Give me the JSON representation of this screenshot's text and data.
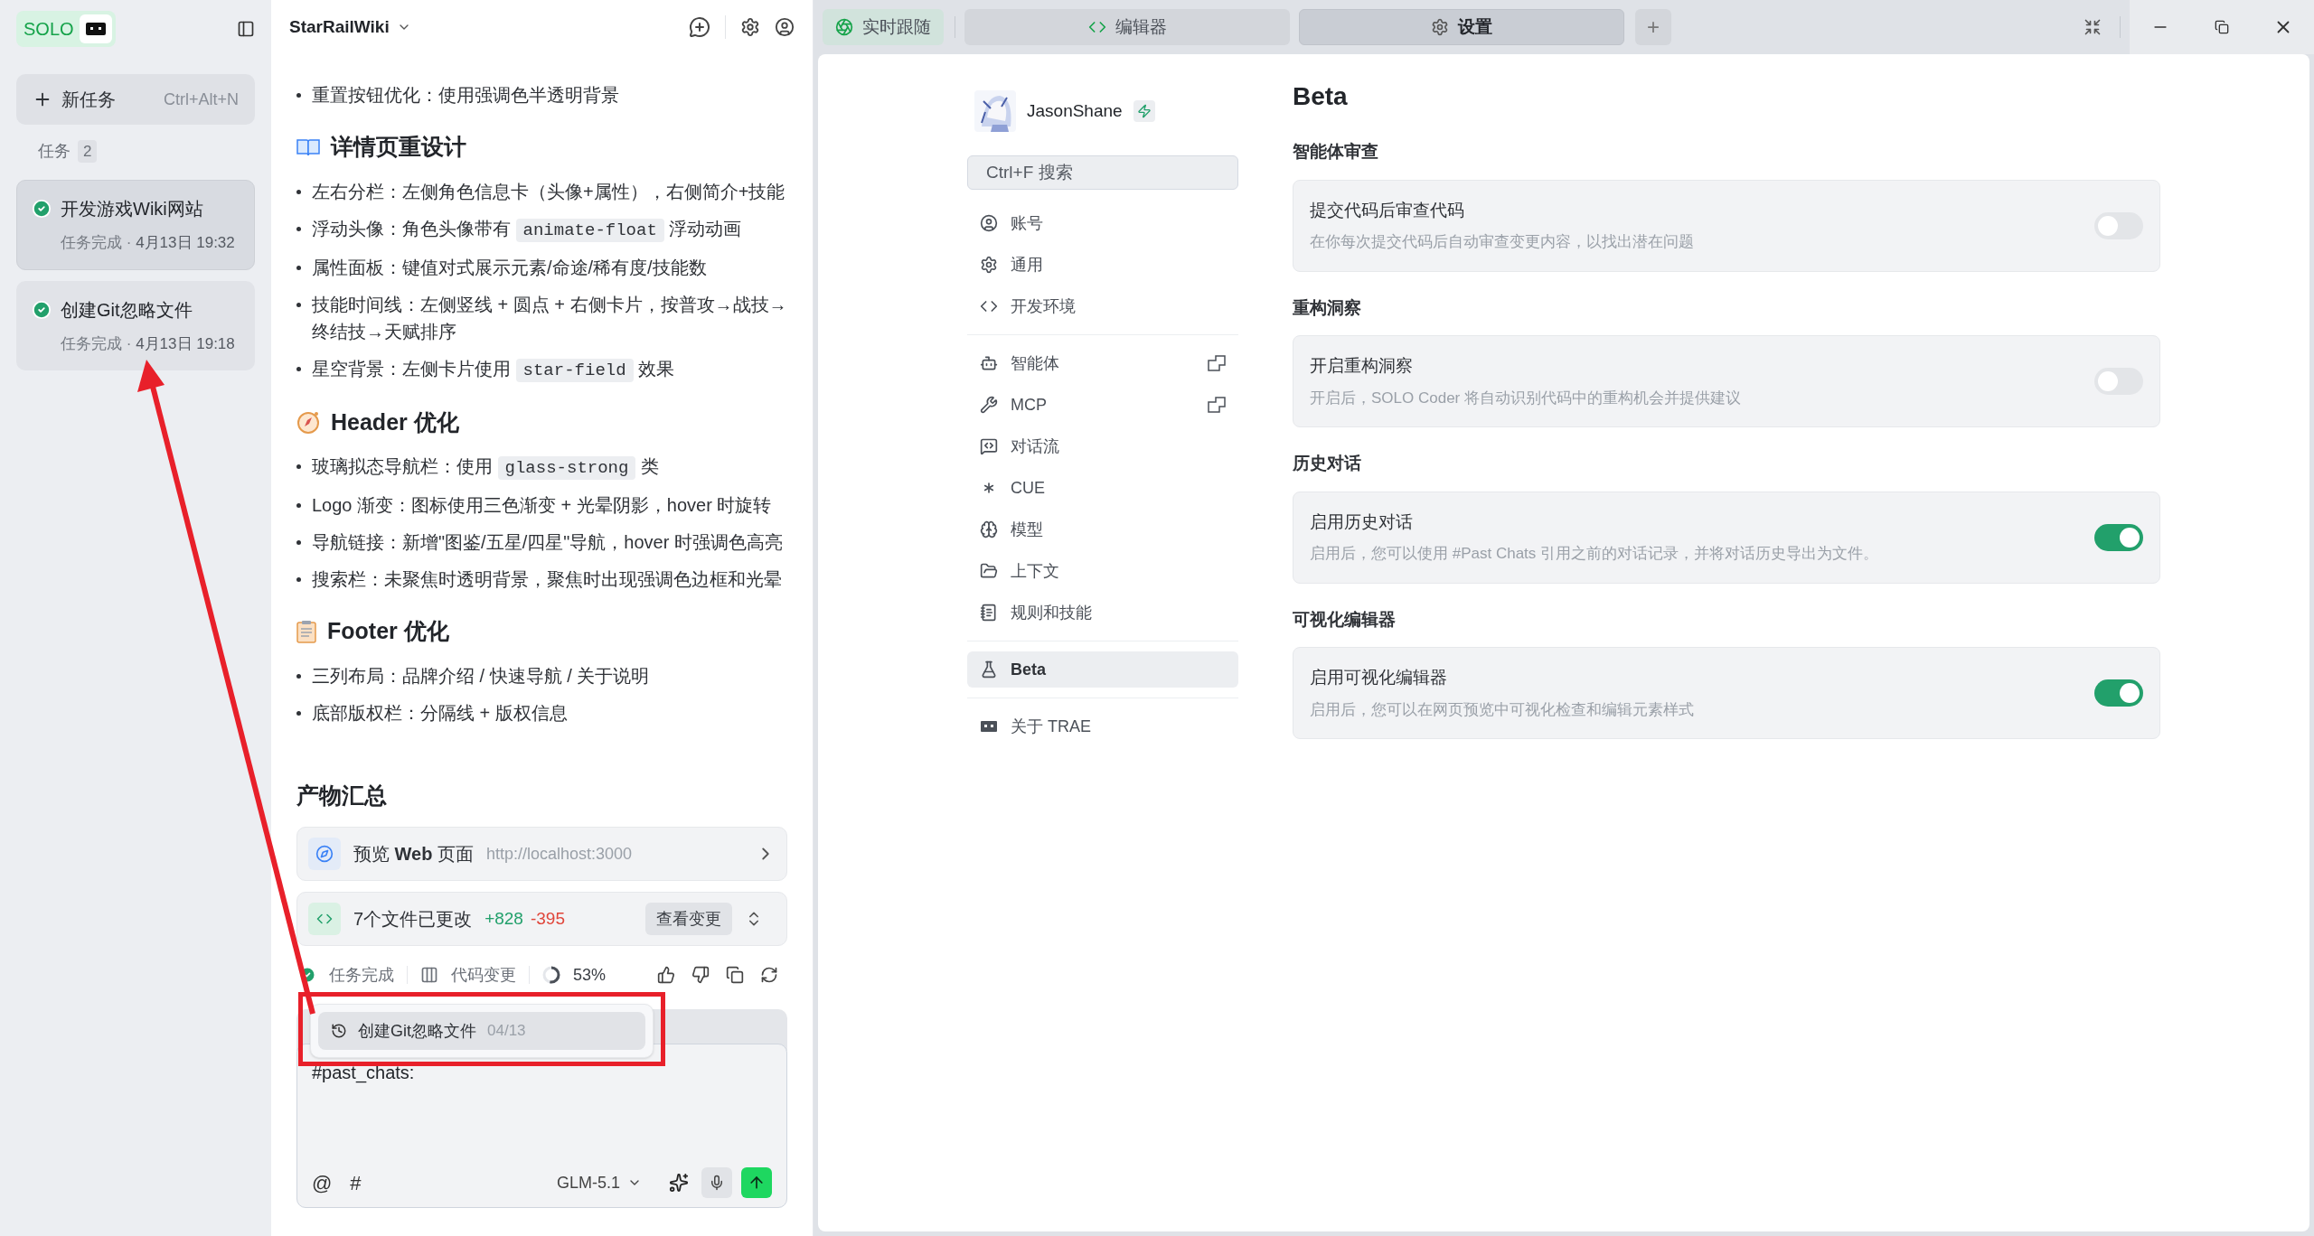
{
  "sidebar": {
    "logo": "SOLO",
    "new_task": {
      "label": "新任务",
      "shortcut": "Ctrl+Alt+N"
    },
    "tasks_heading": {
      "label": "任务",
      "count": "2"
    },
    "tasks": [
      {
        "title": "开发游戏Wiki网站",
        "status": "任务完成",
        "separator": "·",
        "date": "4月13日 19:32",
        "selected": true,
        "done": true
      },
      {
        "title": "创建Git忽略文件",
        "status": "任务完成",
        "separator": "·",
        "date": "4月13日 19:18",
        "selected": false,
        "done": true
      }
    ]
  },
  "chat": {
    "project": "StarRailWiki",
    "intro_items": [
      [
        {
          "kind": "text",
          "text": "重置按钮优化：使用强调色半透明背景"
        }
      ]
    ],
    "sections": [
      {
        "heading": "详情页重设计",
        "items": [
          [
            {
              "kind": "text",
              "text": "左右分栏：左侧角色信息卡（头像+属性），右侧简介+技能"
            }
          ],
          [
            {
              "kind": "text",
              "text": "浮动头像：角色头像带有 "
            },
            {
              "kind": "code",
              "text": "animate-float"
            },
            {
              "kind": "text",
              "text": " 浮动动画"
            }
          ],
          [
            {
              "kind": "text",
              "text": "属性面板：键值对式展示元素/命途/稀有度/技能数"
            }
          ],
          [
            {
              "kind": "text",
              "text": "技能时间线：左侧竖线 + 圆点 + 右侧卡片，按普攻→战技→终结技→天赋排序"
            }
          ],
          [
            {
              "kind": "text",
              "text": "星空背景：左侧卡片使用 "
            },
            {
              "kind": "code",
              "text": "star-field"
            },
            {
              "kind": "text",
              "text": " 效果"
            }
          ]
        ]
      },
      {
        "heading": "Header 优化",
        "items": [
          [
            {
              "kind": "text",
              "text": "玻璃拟态导航栏：使用 "
            },
            {
              "kind": "code",
              "text": "glass-strong"
            },
            {
              "kind": "text",
              "text": " 类"
            }
          ],
          [
            {
              "kind": "text",
              "text": "Logo 渐变：图标使用三色渐变 + 光晕阴影，hover 时旋转"
            }
          ],
          [
            {
              "kind": "text",
              "text": "导航链接：新增\"图鉴/五星/四星\"导航，hover 时强调色高亮"
            }
          ],
          [
            {
              "kind": "text",
              "text": "搜索栏：未聚焦时透明背景，聚焦时出现强调色边框和光晕"
            }
          ]
        ]
      },
      {
        "heading": "Footer 优化",
        "items": [
          [
            {
              "kind": "text",
              "text": "三列布局：品牌介绍 / 快速导航 / 关于说明"
            }
          ],
          [
            {
              "kind": "text",
              "text": "底部版权栏：分隔线 + 版权信息"
            }
          ]
        ]
      }
    ],
    "summary_title": "产物汇总",
    "preview": {
      "label": "预览 **Web** 页面",
      "url": "http://localhost:3000"
    },
    "changes": {
      "label": "7个文件已更改",
      "added": "+828",
      "removed": "-395",
      "button": "查看变更"
    },
    "status": {
      "done": "任务完成",
      "code_changes": "代码变更",
      "percent": "53%",
      "level": 0.53
    },
    "popup": {
      "title": "创建Git忽略文件",
      "date": "04/13"
    },
    "composer": {
      "value": "#past_chats:",
      "at": "@",
      "hash": "#",
      "model": "GLM-5.1"
    }
  },
  "topbar": {
    "tabs": [
      {
        "label": "实时跟随",
        "selected": false
      },
      {
        "label": "编辑器",
        "selected": false
      },
      {
        "label": "设置",
        "selected": true
      }
    ],
    "add": "+"
  },
  "settings": {
    "user": "JasonShane",
    "search": {
      "placeholder": "Ctrl+F 搜索"
    },
    "nav_groups": [
      [
        {
          "label": "账号",
          "selected": false,
          "external": false
        },
        {
          "label": "通用",
          "selected": false,
          "external": false
        },
        {
          "label": "开发环境",
          "selected": false,
          "external": false
        }
      ],
      [
        {
          "label": "智能体",
          "selected": false,
          "external": true
        },
        {
          "label": "MCP",
          "selected": false,
          "external": true
        },
        {
          "label": "对话流",
          "selected": false,
          "external": false
        },
        {
          "label": "CUE",
          "selected": false,
          "external": false
        },
        {
          "label": "模型",
          "selected": false,
          "external": false
        },
        {
          "label": "上下文",
          "selected": false,
          "external": false
        },
        {
          "label": "规则和技能",
          "selected": false,
          "external": false
        }
      ],
      [
        {
          "label": "Beta",
          "selected": true,
          "external": false
        }
      ],
      [
        {
          "label": "关于 TRAE",
          "selected": false,
          "external": false
        }
      ]
    ],
    "title": "Beta",
    "sections": [
      {
        "heading": "智能体审查",
        "title": "提交代码后审查代码",
        "description": "在你每次提交代码后自动审查变更内容，以找出潜在问题",
        "on": false
      },
      {
        "heading": "重构洞察",
        "title": "开启重构洞察",
        "description": "开启后，SOLO Coder 将自动识别代码中的重构机会并提供建议",
        "on": false
      },
      {
        "heading": "历史对话",
        "title": "启用历史对话",
        "description": "启用后，您可以使用 #Past Chats 引用之前的对话记录，并将对话历史导出为文件。",
        "on": true
      },
      {
        "heading": "可视化编辑器",
        "title": "启用可视化编辑器",
        "description": "启用后，您可以在网页预览中可视化检查和编辑元素样式",
        "on": true
      }
    ]
  }
}
